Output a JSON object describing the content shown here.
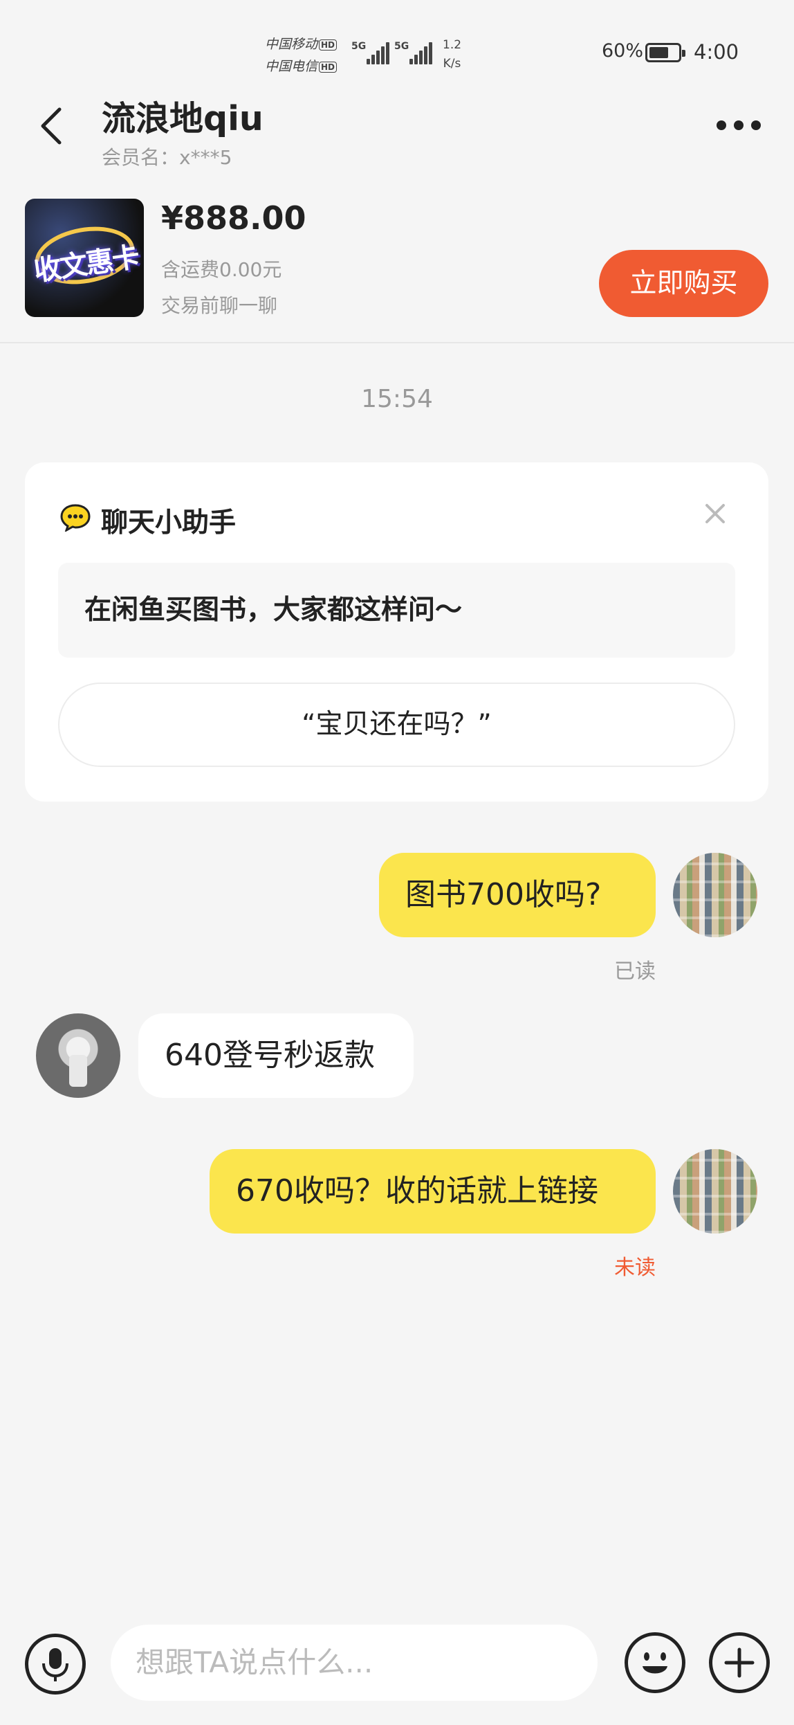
{
  "status_bar": {
    "carrier1": "中国移动",
    "carrier2": "中国电信",
    "hd": "HD",
    "network1": "5G",
    "network2": "5G",
    "net_speed_value": "1.2",
    "net_speed_unit": "K/s",
    "battery_percent": "60%",
    "battery_level": 0.6,
    "time": "4:00"
  },
  "header": {
    "title": "流浪地qiu",
    "member_name": "会员名：x***5"
  },
  "product": {
    "thumbnail_text": "收文惠卡",
    "price": "¥888.00",
    "shipping": "含运费0.00元",
    "note": "交易前聊一聊",
    "buy_label": "立即购买"
  },
  "chat": {
    "timestamp": "15:54",
    "assistant": {
      "title": "聊天小助手",
      "hint": "在闲鱼买图书，大家都这样问～",
      "suggestion": "“宝贝还在吗？”"
    },
    "messages": [
      {
        "side": "mine",
        "text": "图书700收吗?",
        "status": "已读"
      },
      {
        "side": "theirs",
        "text": "640登号秒返款"
      },
      {
        "side": "mine",
        "text": "670收吗？收的话就上链接",
        "status": "未读"
      }
    ]
  },
  "input": {
    "placeholder": "想跟TA说点什么..."
  },
  "colors": {
    "accent": "#f05b32",
    "my_bubble": "#fbe54d",
    "unread": "#f05b32",
    "read": "#999999"
  }
}
